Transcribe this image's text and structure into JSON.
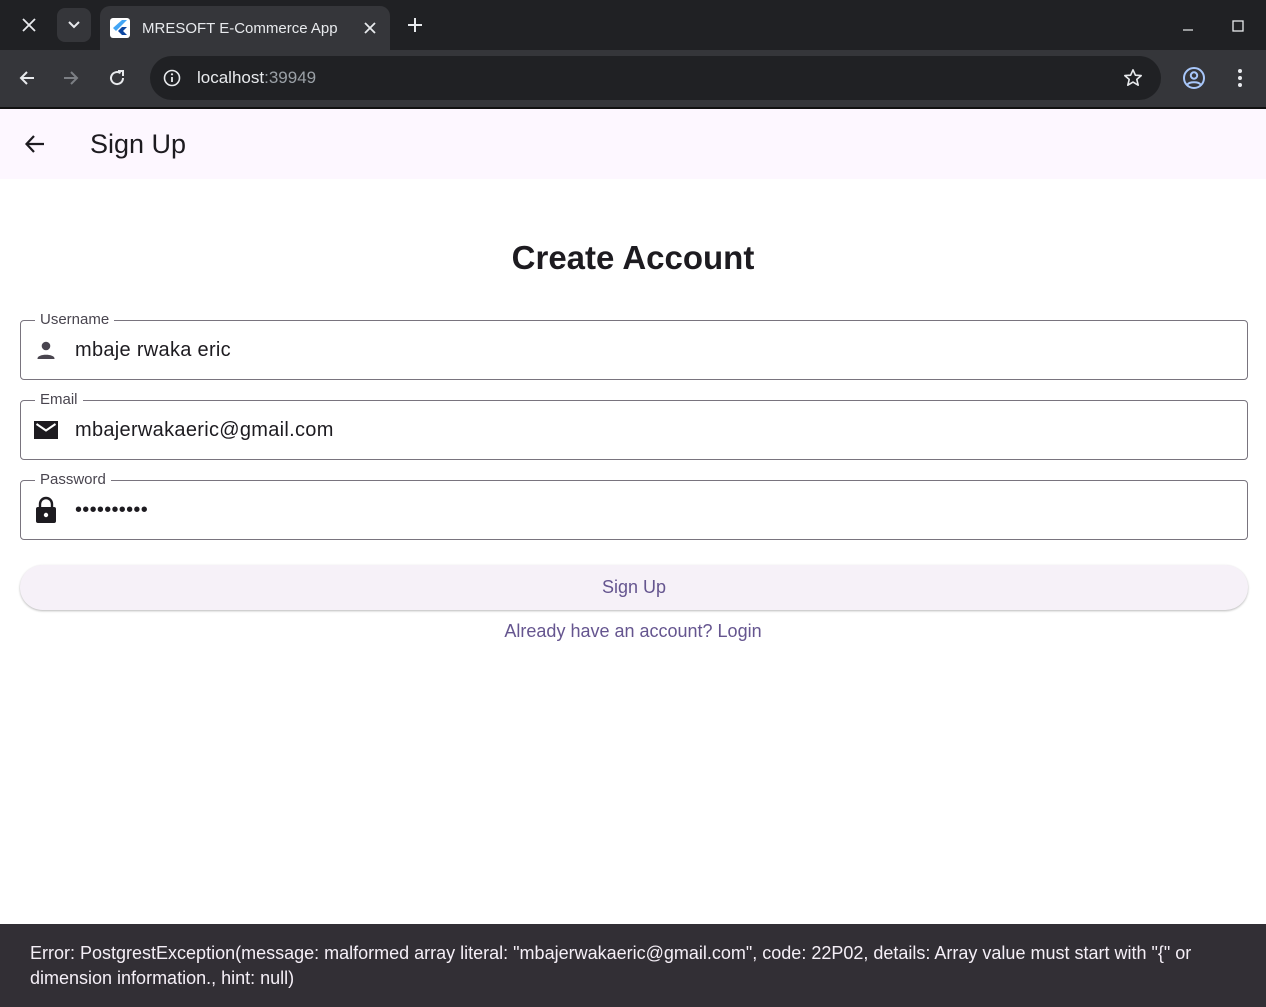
{
  "browser": {
    "tab_title": "MRESOFT E-Commerce App",
    "url_host": "localhost",
    "url_port": ":39949"
  },
  "appbar": {
    "title": "Sign Up"
  },
  "form": {
    "heading": "Create Account",
    "username": {
      "label": "Username",
      "value": "mbaje rwaka eric",
      "icon": "person-icon"
    },
    "email": {
      "label": "Email",
      "value": "mbajerwakaeric@gmail.com",
      "icon": "mail-icon"
    },
    "password": {
      "label": "Password",
      "value": "••••••••••",
      "icon": "lock-icon"
    },
    "submit_label": "Sign Up",
    "login_link": "Already have an account? Login"
  },
  "snackbar": {
    "message": "Error: PostgrestException(message: malformed array literal: \"mbajerwakaeric@gmail.com\", code: 22P02, details: Array value must start with \"{\" or dimension information., hint: null)"
  },
  "colors": {
    "appbar_bg": "#fdf7ff",
    "primary": "#65558f",
    "snackbar_bg": "#322f35"
  }
}
